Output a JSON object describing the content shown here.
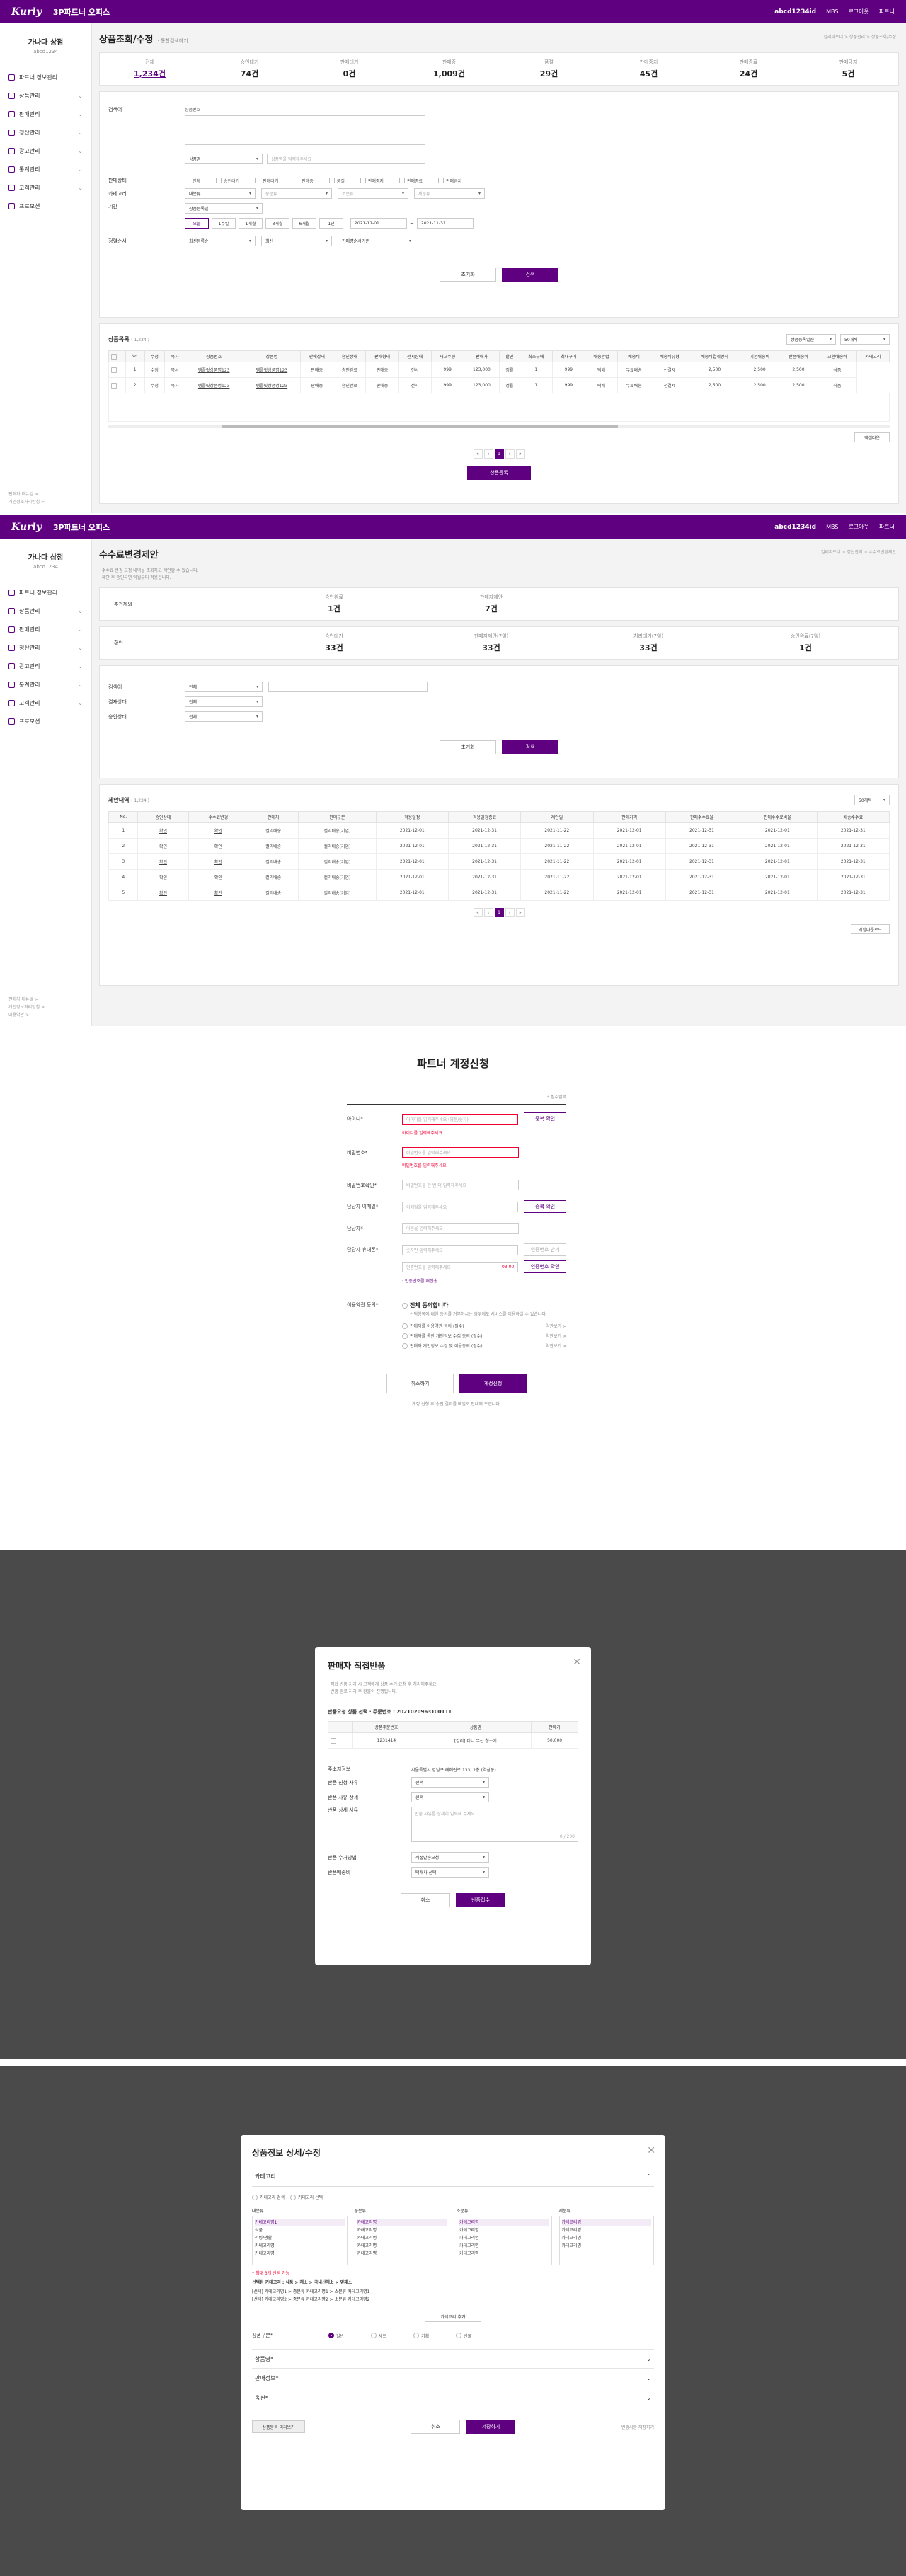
{
  "app": {
    "logo": "Kurly",
    "title": "3P파트너 오피스",
    "user": "abcd1234id",
    "links": [
      "MBS",
      "로그아웃",
      "파트너"
    ]
  },
  "sidebar": {
    "brand": "가나다 상점",
    "id": "abcd1234",
    "items": [
      "파트너 정보관리",
      "상품관리",
      "판매관리",
      "정산관리",
      "광고관리",
      "통계관리",
      "고객관리",
      "프로모션"
    ],
    "footer": [
      "판매자 매뉴얼 >",
      "개인정보처리방침 >",
      "이용약관 >"
    ]
  },
  "s1": {
    "title": "상품조회/수정",
    "sub": "· 통합검색하기",
    "breadcrumb": "컬리파트너 > 상품관리 > 상품조회/수정",
    "stats": [
      {
        "l": "전체",
        "v": "1,234건"
      },
      {
        "l": "승인대기",
        "v": "74건"
      },
      {
        "l": "판매대기",
        "v": "0건"
      },
      {
        "l": "판매중",
        "v": "1,009건"
      },
      {
        "l": "품절",
        "v": "29건"
      },
      {
        "l": "판매중지",
        "v": "45건"
      },
      {
        "l": "판매종료",
        "v": "24건"
      },
      {
        "l": "판매금지",
        "v": "5건"
      }
    ],
    "search_label": "검색어",
    "search_type": "상품번호",
    "search_type2": "상품명",
    "search_ph": "상품명을 입력해주세요",
    "status_label": "판매상태",
    "statuses": [
      "전체",
      "승인대기",
      "판매대기",
      "판매중",
      "품절",
      "판매중지",
      "판매종료",
      "판매금지"
    ],
    "cat_label": "카테고리",
    "cats": [
      "대분류",
      "중분류",
      "소분류",
      "세분류"
    ],
    "period_label": "기간",
    "period_type": "상품등록일",
    "tabs": [
      "오늘",
      "1주일",
      "1개월",
      "3개월",
      "6개월",
      "1년"
    ],
    "date_from": "2021-11-01",
    "date_to": "2021-11-31",
    "sort_label": "정렬순서",
    "sorts": [
      "최신등록순",
      "최신",
      "판매량순서기준"
    ],
    "reset": "초기화",
    "search": "검색",
    "list_title": "상품목록",
    "list_count": "( 1,234 )",
    "list_sel1": "상품등록일순",
    "list_sel2": "50개씩",
    "cols": [
      "No.",
      "수정",
      "복사",
      "상품번호",
      "상품명",
      "판매상태",
      "승인상태",
      "판매형태",
      "전시상태",
      "재고수량",
      "판매가",
      "할인",
      "최소구매",
      "최대구매",
      "배송방법",
      "배송비",
      "배송비유형",
      "배송비결제방식",
      "기본배송비",
      "반품배송비",
      "교환배송비",
      "카테고리"
    ],
    "rows": [
      [
        "1",
        "수정",
        "복사",
        "템플릿상품명123",
        "템플릿상품명123",
        "판매중",
        "승인완료",
        "판매중",
        "전시",
        "999",
        "123,000",
        "정률",
        "1",
        "999",
        "택배",
        "무료배송",
        "선결제",
        "2,500",
        "2,500",
        "2,500",
        "식품"
      ],
      [
        "2",
        "수정",
        "복사",
        "템플릿상품명123",
        "템플릿상품명123",
        "판매중",
        "승인완료",
        "판매중",
        "전시",
        "999",
        "123,000",
        "정률",
        "1",
        "999",
        "택배",
        "무료배송",
        "선결제",
        "2,500",
        "2,500",
        "2,500",
        "식품"
      ]
    ],
    "excel": "엑셀다운",
    "pages": [
      "«",
      "‹",
      "1",
      "›",
      "»"
    ],
    "register": "상품등록"
  },
  "s2": {
    "title": "수수료변경제안",
    "breadcrumb": "컬리파트너 > 정산관리 > 수수료변경제안",
    "notes": [
      "· 수수료 변경 요청 내역을 조회하고 제안할 수 있습니다.",
      "· 제안 후 승인되면 익월부터 적용됩니다."
    ],
    "sum1_label": "추천제외",
    "sum1": [
      {
        "l": "승인완료",
        "v": "1건"
      },
      {
        "l": "판매자제안",
        "v": "7건"
      }
    ],
    "sum2_label": "확인",
    "sum2": [
      {
        "l": "승인대기",
        "v": "33건"
      },
      {
        "l": "판매자제안(7일)",
        "v": "33건"
      },
      {
        "l": "처리대기(7일)",
        "v": "33건"
      },
      {
        "l": "승인완료(7일)",
        "v": "1건"
      }
    ],
    "f1": "검색어",
    "f1v": "전체",
    "f2": "결재상태",
    "f2v": "전체",
    "f3": "승인상태",
    "f3v": "전체",
    "reset": "초기화",
    "search": "검색",
    "list_title": "제안내역",
    "list_count": "( 1,234 )",
    "sel": "50개씩",
    "cols": [
      "No.",
      "승인상태",
      "수수료변경",
      "판매처",
      "판매구분",
      "적용일정",
      "적용일정종료",
      "제안일",
      "판매가격",
      "판매수수료율",
      "판매수수료비율",
      "배송수수료",
      "변경사유"
    ],
    "rows": [
      [
        "1",
        "확인",
        "확인",
        "컬리배송",
        "컬리배송(기업)",
        "2021-12-01",
        "2021-12-31",
        "2021-11-22",
        "2021-12-01",
        "2021-12-31",
        "2021-12-01",
        "2021-12-31"
      ],
      [
        "2",
        "확인",
        "확인",
        "컬리배송",
        "컬리배송(기업)",
        "2021-12-01",
        "2021-12-31",
        "2021-11-22",
        "2021-12-01",
        "2021-12-31",
        "2021-12-01",
        "2021-12-31"
      ],
      [
        "3",
        "확인",
        "확인",
        "컬리배송",
        "컬리배송(기업)",
        "2021-12-01",
        "2021-12-31",
        "2021-11-22",
        "2021-12-01",
        "2021-12-31",
        "2021-12-01",
        "2021-12-31"
      ],
      [
        "4",
        "확인",
        "확인",
        "컬리배송",
        "컬리배송(기업)",
        "2021-12-01",
        "2021-12-31",
        "2021-11-22",
        "2021-12-01",
        "2021-12-31",
        "2021-12-01",
        "2021-12-31"
      ],
      [
        "5",
        "확인",
        "확인",
        "컬리배송",
        "컬리배송(기업)",
        "2021-12-01",
        "2021-12-31",
        "2021-11-22",
        "2021-12-01",
        "2021-12-31",
        "2021-12-01",
        "2021-12-31"
      ]
    ],
    "excel": "엑셀다운로드",
    "pages": [
      "«",
      "‹",
      "1",
      "›",
      "»"
    ]
  },
  "s3": {
    "title": "파트너 계정신청",
    "required": "* 필수입력",
    "fields": [
      {
        "l": "아이디*",
        "ph": "아이디를 입력해주세요 (영문/숫자)",
        "btn": "중복 확인",
        "err": "아이디를 입력해주세요"
      },
      {
        "l": "비밀번호*",
        "ph": "비밀번호를 입력해주세요",
        "err": "비밀번호를 입력해주세요"
      },
      {
        "l": "비밀번호확인*",
        "ph": "비밀번호를 한 번 더 입력해주세요"
      },
      {
        "l": "담당자 이메일*",
        "ph": "이메일을 입력해주세요",
        "btn": "중복 확인"
      },
      {
        "l": "담당자*",
        "ph": "이름을 입력해주세요"
      },
      {
        "l": "담당자 휴대폰*",
        "ph": "숫자만 입력해주세요",
        "btn": "인증번호 받기"
      }
    ],
    "code_ph": "인증번호를 입력해주세요",
    "timer": "03:00",
    "code_btn": "인증번호 확인",
    "code_note": "· 인증번호를 재전송",
    "terms_label": "이용약관 동의*",
    "terms_all": "전체 동의합니다",
    "terms_all_note": "선택항목에 대한 동의를 거부하시는 경우에도 서비스를 이용하실 수 있습니다.",
    "terms": [
      "판매자를 이용약관 동의 (필수)",
      "판매자를 통한 개인정보 수집 동의 (필수)",
      "판매자 개인정보 수집 및 이용동의 (필수)"
    ],
    "view": "약관보기 >",
    "cancel": "취소하기",
    "submit": "계정신청",
    "footnote": "계정 신청 후 승인 결과를 메일로 안내해 드립니다."
  },
  "s4": {
    "title": "판매자 직접반품",
    "notes": [
      "· 직접 반품 처리 시 고객에게 상품 수거 요청 후 처리해주세요.",
      "· 반품 완료 처리 후 환불이 진행됩니다."
    ],
    "order_line": "반품요청 상품 선택 · 주문번호 : 2021020963100111",
    "cols": [
      "상품주문번호",
      "상품명",
      "판매가"
    ],
    "row": [
      "1231414",
      "[컬리] 미니 무선 청소기",
      "50,000"
    ],
    "fields": [
      {
        "l": "주소지정보",
        "v": "서울특별시 강남구 테헤란로 133, 2층 (역삼동)"
      },
      {
        "l": "반품 신청 사유",
        "v": "선택"
      },
      {
        "l": "반품 사유 상세",
        "v": "선택"
      },
      {
        "l": "반품 상세 사유",
        "v": "반품 사유를 상세히 입력해 주세요."
      },
      {
        "l": "반품 수거방법",
        "v": "직접발송요청"
      },
      {
        "l": "반품배송비",
        "v": "택배사 선택"
      }
    ],
    "counter": "0 / 200",
    "cancel": "취소",
    "submit": "반품접수"
  },
  "s5": {
    "title": "상품정보 상세/수정",
    "acc1": "카테고리",
    "tabs": [
      "카테고리 검색",
      "카테고리 선택"
    ],
    "cols": [
      "대분류",
      "중분류",
      "소분류",
      "세분류"
    ],
    "items": [
      "카테고리명1",
      "식품",
      "리빙/생활",
      "카테고리명",
      "카테고리명",
      "카테고리명"
    ],
    "warn": "* 최대 3개 선택 가능",
    "path": "선택된 카테고리 : 식품 > 채소 > 국내산채소 > 잎채소",
    "lines": [
      "[선택] 카테고리명1 > 중분류 카테고리명1 > 소분류 카테고리명1",
      "[선택] 카테고리명2 > 중분류 카테고리명2 > 소분류 카테고리명2"
    ],
    "add": "카테고리 추가",
    "type_label": "상품구분*",
    "types": [
      "일반",
      "세트",
      "기획",
      "선물"
    ],
    "accs": [
      "상품명*",
      "판매정보*",
      "옵션*"
    ],
    "preview": "상품등록 미리보기",
    "cancel": "취소",
    "save": "저장하기",
    "footnote": "변경사항 저장하기"
  }
}
